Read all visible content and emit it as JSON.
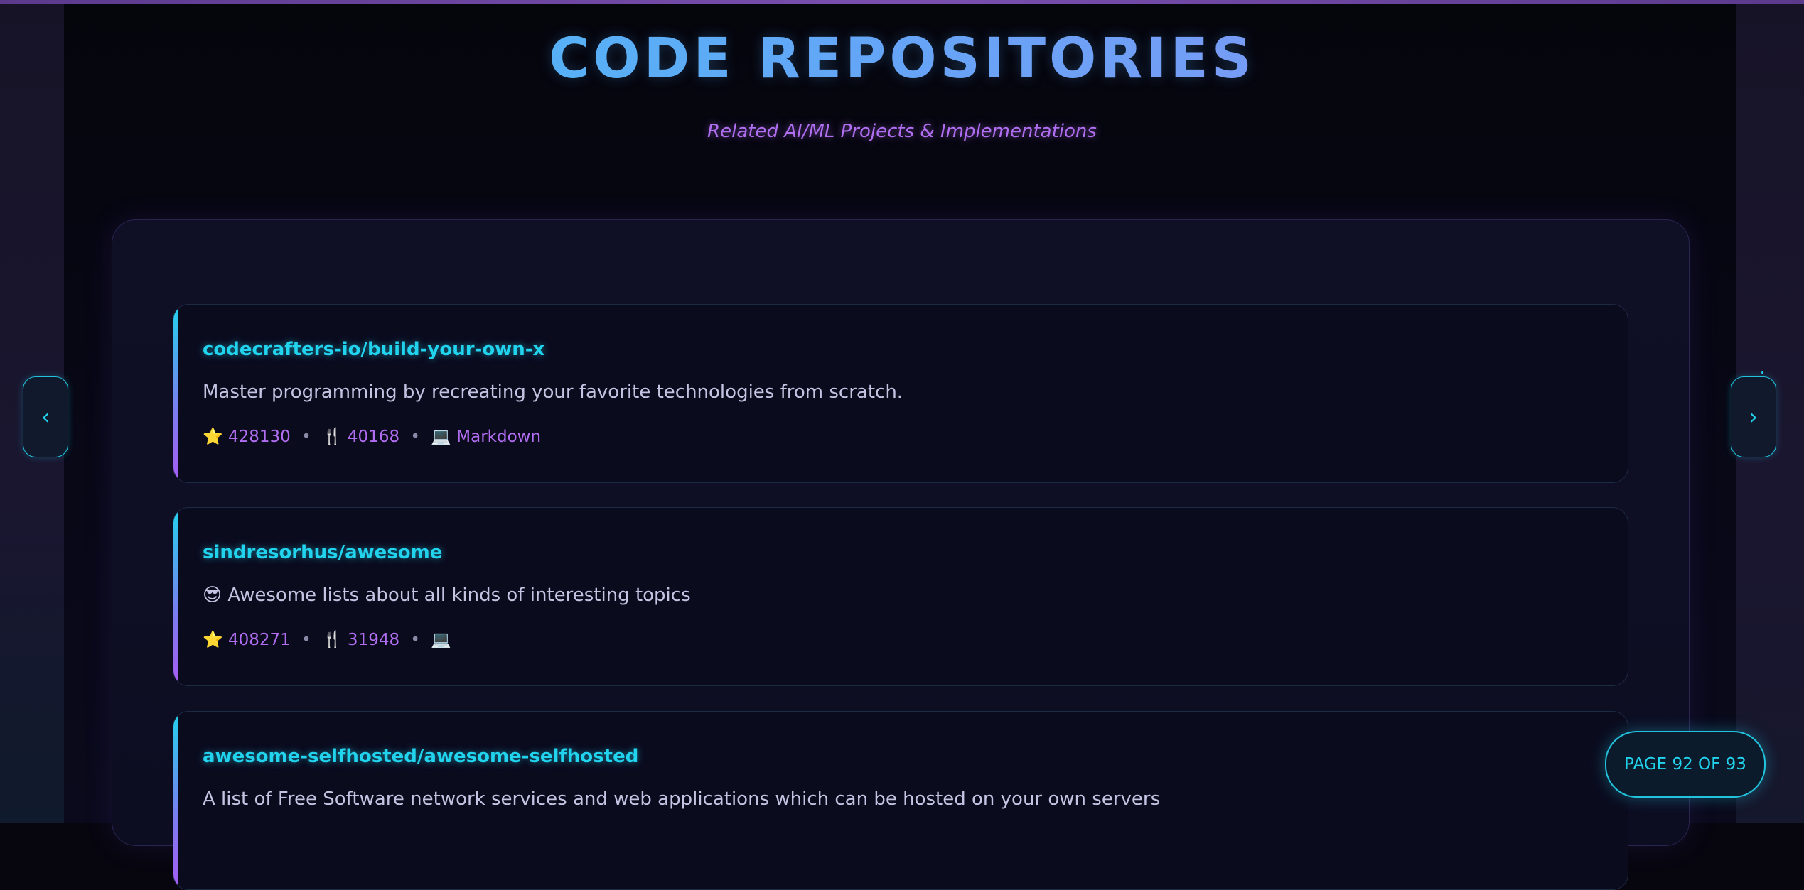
{
  "header": {
    "title": "CODE REPOSITORIES",
    "subtitle": "Related AI/ML Projects & Implementations"
  },
  "nav": {
    "prev_label": "‹",
    "next_label": "›"
  },
  "pagination": {
    "label": "PAGE 92 OF 93",
    "current": 92,
    "total": 93
  },
  "repositories": [
    {
      "name": "codecrafters-io/build-your-own-x",
      "description": "Master programming by recreating your favorite technologies from scratch.",
      "stars_icon": "⭐",
      "stars": "428130",
      "forks_icon": "🍴",
      "forks": "40168",
      "language_icon": "💻",
      "language": "Markdown"
    },
    {
      "name": "sindresorhus/awesome",
      "description": "😎 Awesome lists about all kinds of interesting topics",
      "stars_icon": "⭐",
      "stars": "408271",
      "forks_icon": "🍴",
      "forks": "31948",
      "language_icon": "💻",
      "language": ""
    },
    {
      "name": "awesome-selfhosted/awesome-selfhosted",
      "description": "A list of Free Software network services and web applications which can be hosted on your own servers",
      "stars_icon": "",
      "stars": "",
      "forks_icon": "",
      "forks": "",
      "language_icon": "",
      "language": ""
    }
  ],
  "colors": {
    "accent_cyan": "#22d3ee",
    "accent_purple": "#b26ef2",
    "background": "#07060f"
  }
}
